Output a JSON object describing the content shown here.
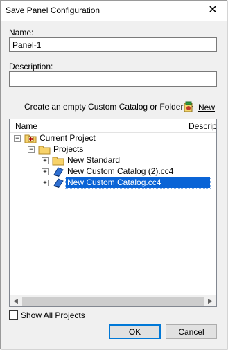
{
  "window": {
    "title": "Save Panel Configuration"
  },
  "form": {
    "name_label": "Name:",
    "name_value": "Panel-1",
    "description_label": "Description:",
    "description_value": ""
  },
  "create": {
    "text": "Create an empty Custom Catalog or Folder ->",
    "new_label": "New"
  },
  "tree": {
    "columns": [
      "Name",
      "Description"
    ],
    "rows": [
      {
        "label": "Current Project",
        "icon": "project-icon",
        "expander": "−"
      },
      {
        "label": "Projects",
        "icon": "folder-icon",
        "expander": "−"
      },
      {
        "label": "New Standard",
        "icon": "folder-icon",
        "expander": "+"
      },
      {
        "label": "New Custom Catalog (2).cc4",
        "icon": "catalog-icon",
        "expander": "+"
      },
      {
        "label": "New Custom Catalog.cc4",
        "icon": "catalog-icon",
        "expander": "+",
        "selected": true
      }
    ]
  },
  "options": {
    "show_all_label": "Show All Projects",
    "show_all_checked": false
  },
  "buttons": {
    "ok": "OK",
    "cancel": "Cancel"
  }
}
